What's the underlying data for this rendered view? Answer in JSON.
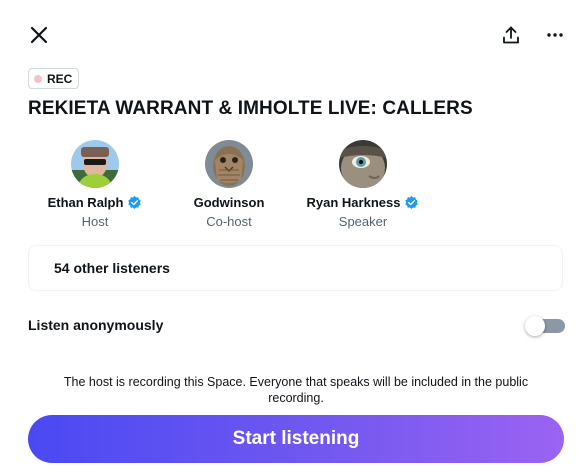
{
  "header": {
    "close_icon": "close-icon",
    "share_icon": "share-icon",
    "more_icon": "more-horizontal-icon"
  },
  "recording_badge": {
    "label": "REC",
    "dot_color": "#f4c0cc"
  },
  "space": {
    "title": "REKIETA WARRANT & IMHOLTE LIVE: CALLERS"
  },
  "participants": [
    {
      "name": "Ethan Ralph",
      "role": "Host",
      "verified": true
    },
    {
      "name": "Godwinson",
      "role": "Co-host",
      "verified": false
    },
    {
      "name": "Ryan Harkness",
      "role": "Speaker",
      "verified": true
    }
  ],
  "listeners": {
    "label": "54 other listeners"
  },
  "anonymous": {
    "label": "Listen anonymously",
    "enabled": false
  },
  "recording_note": "The host is recording this Space. Everyone that speaks will be included in the public recording.",
  "start_button": {
    "label": "Start listening"
  },
  "colors": {
    "verified": "#1d9bf0",
    "button_gradient_start": "#4a49f3",
    "button_gradient_end": "#9b63f2",
    "secondary_text": "#536471"
  }
}
